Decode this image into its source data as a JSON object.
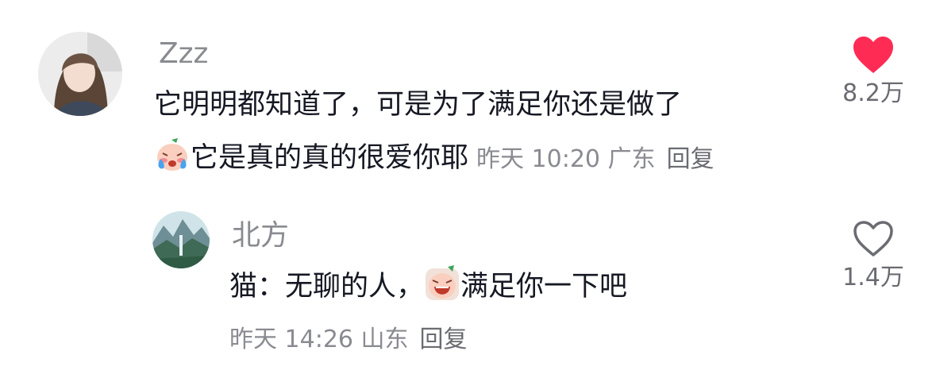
{
  "colors": {
    "like_active": "#fe2c55",
    "text_primary": "#161823",
    "text_secondary": "#8a8b91"
  },
  "comments": [
    {
      "username": "Zzz",
      "text_line1": "它明明都知道了，可是为了满足你还是做了",
      "emoji": "crying-face-emoji",
      "text_line2": "它是真的真的很爱你耶",
      "time": "昨天 10:20",
      "location": "广东",
      "reply_label": "回复",
      "like_icon": "heart-filled-icon",
      "likes": "8.2万",
      "liked": true
    },
    {
      "username": "北方",
      "text_before": "猫：无聊的人，",
      "emoji": "laughing-face-emoji",
      "text_after": "满足你一下吧",
      "time": "昨天 14:26",
      "location": "山东",
      "reply_label": "回复",
      "like_icon": "heart-outline-icon",
      "likes": "1.4万",
      "liked": false
    }
  ]
}
